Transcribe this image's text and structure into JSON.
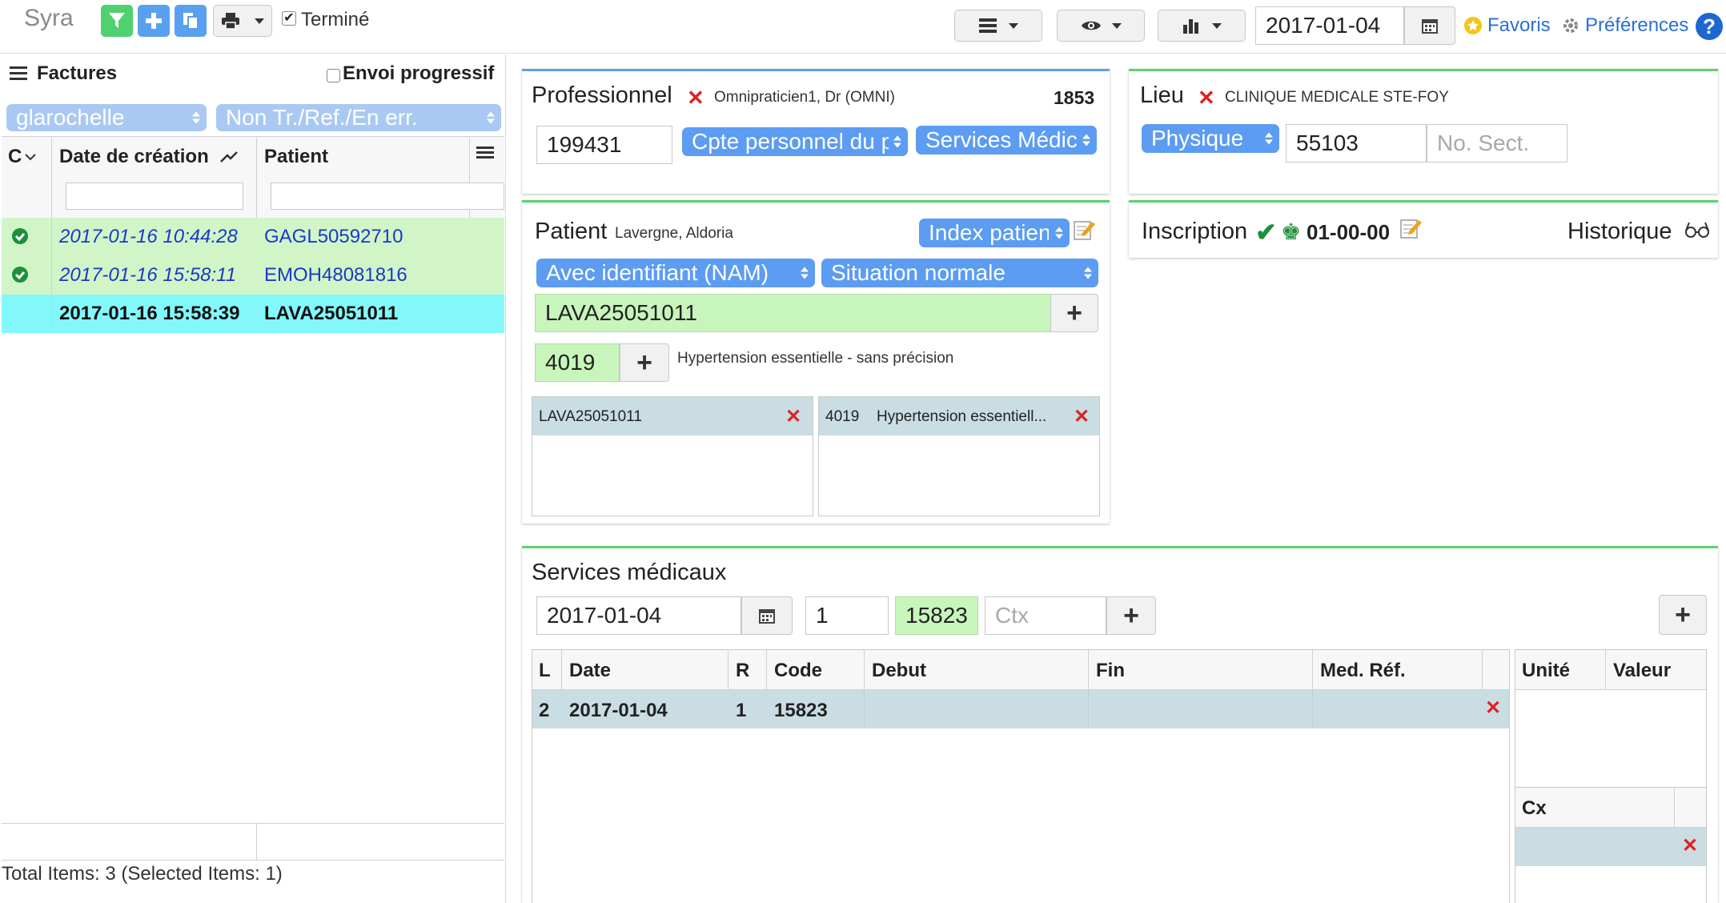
{
  "app": {
    "title": "Syra"
  },
  "toolbar": {
    "done_label": "Terminé",
    "date": "2017-01-04",
    "favorites_label": "Favoris",
    "preferences_label": "Préférences"
  },
  "invoices": {
    "title": "Factures",
    "progressive_label": "Envoi progressif",
    "user_filter": "glarochelle",
    "status_filter": "Non Tr./Ref./En err.",
    "columns": {
      "c": "C",
      "date": "Date de création",
      "patient": "Patient"
    },
    "rows": [
      {
        "date": "2017-01-16 10:44:28",
        "patient": "GAGL50592710",
        "status": "ok"
      },
      {
        "date": "2017-01-16 15:58:11",
        "patient": "EMOH48081816",
        "status": "ok"
      },
      {
        "date": "2017-01-16 15:58:39",
        "patient": "LAVA25051011",
        "status": "selected"
      }
    ],
    "footer": "Total Items: 3 (Selected Items: 1)"
  },
  "professional": {
    "title": "Professionnel",
    "name": "Omnipraticien1, Dr (OMNI)",
    "number": "1853",
    "id_value": "199431",
    "account_select": "Cpte personnel du p",
    "service_select": "Services Médicaux"
  },
  "location": {
    "title": "Lieu",
    "name": "CLINIQUE MEDICALE STE-FOY",
    "type_select": "Physique",
    "code": "55103",
    "sector_placeholder": "No. Sect."
  },
  "patient": {
    "title": "Patient",
    "name": "Lavergne, Aldoria",
    "index_select": "Index patient",
    "id_type_select": "Avec identifiant (NAM)",
    "situation_select": "Situation normale",
    "nam_value": "LAVA25051011",
    "diag_code": "4019",
    "diag_desc": "Hypertension essentielle - sans précision",
    "list_nam": "LAVA25051011",
    "list_diag_code": "4019",
    "list_diag_desc": "Hypertension essentiell..."
  },
  "registration": {
    "title": "Inscription",
    "code": "01-00-00",
    "history_label": "Historique"
  },
  "services": {
    "title": "Services médicaux",
    "date": "2017-01-04",
    "qty": "1",
    "code": "15823",
    "ctx_placeholder": "Ctx",
    "columns": {
      "l": "L",
      "date": "Date",
      "r": "R",
      "code": "Code",
      "debut": "Debut",
      "fin": "Fin",
      "med_ref": "Med. Réf."
    },
    "rows": [
      {
        "l": "2",
        "date": "2017-01-04",
        "r": "1",
        "code": "15823"
      }
    ],
    "unit_columns": {
      "unit": "Unité",
      "value": "Valeur"
    },
    "cx_label": "Cx"
  },
  "colors": {
    "accent": "#5c9cf2",
    "green_row": "#d2f5c8",
    "selected_row": "#83f8fb",
    "panel_border": "#5dd16b"
  }
}
